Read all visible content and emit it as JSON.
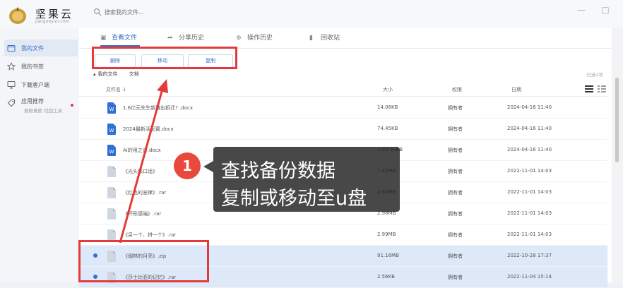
{
  "app": {
    "brand": "坚果云",
    "brand_sub": "jianguoyun.com",
    "search_placeholder": "搜索我的文件..."
  },
  "window_controls": {
    "minimize": "—",
    "maximize": "□"
  },
  "sidebar": {
    "items": [
      {
        "label": "我的文件",
        "icon": "folder-icon",
        "active": true
      },
      {
        "label": "我的书签",
        "icon": "star-icon"
      },
      {
        "label": "下载客户端",
        "icon": "monitor-icon"
      },
      {
        "label": "应用推荐",
        "sub": "按照意愿 找回工具",
        "icon": "tag-icon"
      }
    ]
  },
  "tabs": [
    {
      "label": "查看文件",
      "icon": "files-icon",
      "active": true
    },
    {
      "label": "分享历史",
      "icon": "share-icon"
    },
    {
      "label": "操作历史",
      "icon": "history-icon"
    },
    {
      "label": "回收站",
      "icon": "trash-icon"
    }
  ],
  "toolbar": {
    "delete_label": "删除",
    "move_label": "移动",
    "copy_label": "复制"
  },
  "breadcrumb": {
    "root": "我的文件",
    "current": "文档"
  },
  "selected_count": "已选2项",
  "table": {
    "headers": {
      "name": "文件名 ↓",
      "size": "大小",
      "owner": "权限",
      "date": "日期"
    },
    "rows": [
      {
        "name": "1.6亿元先生新推出拆迁? .docx",
        "size": "14.06KB",
        "owner": "拥有者",
        "date": "2024-04-16 11:40",
        "type": "word",
        "selected": false
      },
      {
        "name": "2024最新活配置.docx",
        "size": "74.45KB",
        "owner": "拥有者",
        "date": "2024-04-16 11:40",
        "type": "word",
        "selected": false
      },
      {
        "name": "Ai的用之道.docx",
        "size": "1.03.30KB",
        "owner": "拥有者",
        "date": "2024-04-16 11:40",
        "type": "word",
        "selected": false
      },
      {
        "name": "《光头那口话》",
        "size": "1.42MB",
        "owner": "拥有者",
        "date": "2022-11-01 14:03",
        "type": "file",
        "selected": false
      },
      {
        "name": "《红色的宠律》.rar",
        "size": "2.65MB",
        "owner": "拥有者",
        "date": "2022-11-01 14:03",
        "type": "file",
        "selected": false
      },
      {
        "name": "《坏形感端》.rar",
        "size": "2.98MB",
        "owner": "拥有者",
        "date": "2022-11-01 14:03",
        "type": "file",
        "selected": false
      },
      {
        "name": "《另一个、拼一个》.rar",
        "size": "2.99MB",
        "owner": "拥有者",
        "date": "2022-11-01 14:03",
        "type": "file",
        "selected": false
      },
      {
        "name": "《烟林的月亮》.zip",
        "size": "91.16MB",
        "owner": "拥有者",
        "date": "2022-10-28 17:37",
        "type": "file",
        "selected": true
      },
      {
        "name": "《莎士比亚的记忆》.rar",
        "size": "2.56KB",
        "owner": "拥有者",
        "date": "2022-11-04 15:14",
        "type": "file",
        "selected": true
      }
    ]
  },
  "callout": {
    "number": "1",
    "line1": "查找备份数据",
    "line2": "复制或移动至u盘"
  },
  "colors": {
    "accent": "#3a6fc7",
    "highlight": "#e33b3b",
    "selected_row": "#dde8f8",
    "callout_bg": "#202020",
    "callout_number": "#e8493c"
  }
}
